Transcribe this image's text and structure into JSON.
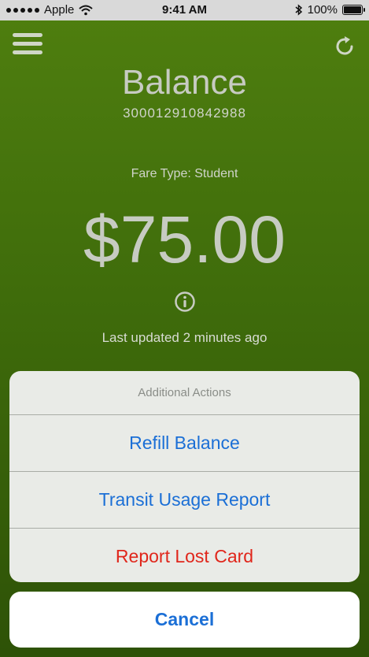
{
  "status_bar": {
    "carrier": "Apple",
    "time": "9:41 AM",
    "battery": "100%"
  },
  "header": {
    "title": "Balance",
    "card_number": "300012910842988"
  },
  "card": {
    "fare_type": "Fare Type: Student",
    "amount": "$75.00",
    "last_updated": "Last updated 2 minutes ago"
  },
  "action_sheet": {
    "title": "Additional Actions",
    "actions": [
      {
        "label": "Refill Balance"
      },
      {
        "label": "Transit Usage Report"
      },
      {
        "label": "Report Lost Card"
      }
    ],
    "cancel_label": "Cancel"
  },
  "colors": {
    "accent": "#1b6fd6",
    "destructive": "#e0261b",
    "background_top": "#4f7f0f",
    "background_bottom": "#2e5207"
  },
  "icons": {
    "menu": "hamburger-menu-icon",
    "refresh": "refresh-icon",
    "info": "info-icon",
    "wifi": "wifi-icon",
    "bluetooth": "bluetooth-icon",
    "battery": "battery-icon"
  }
}
